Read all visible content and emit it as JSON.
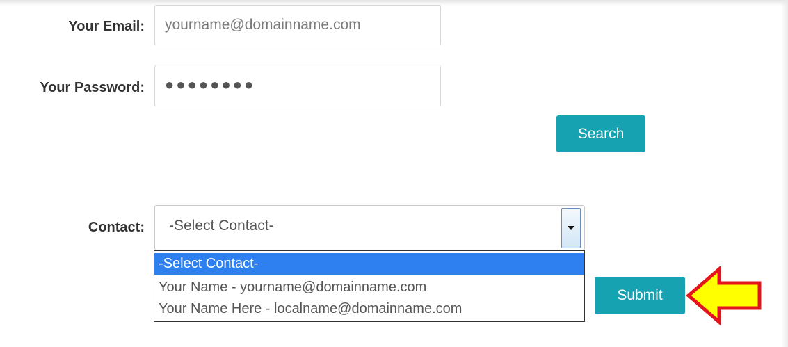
{
  "form": {
    "email": {
      "label": "Your Email:",
      "placeholder": "yourname@domainname.com"
    },
    "password": {
      "label": "Your Password:",
      "masked_value": "●●●●●●●●"
    },
    "search_button": "Search",
    "contact": {
      "label": "Contact:",
      "selected": "-Select Contact-",
      "options": [
        "-Select Contact-",
        "Your Name - yourname@domainname.com",
        "Your Name Here - localname@domainname.com"
      ]
    },
    "submit_button": "Submit"
  },
  "colors": {
    "button": "#17a2b2",
    "selected_option": "#2e7ff0",
    "arrow_fill": "#ffff00",
    "arrow_stroke": "#e3141b"
  },
  "icons": {
    "select_arrow": "triangle-down-icon",
    "pointer": "left-arrow-icon"
  }
}
